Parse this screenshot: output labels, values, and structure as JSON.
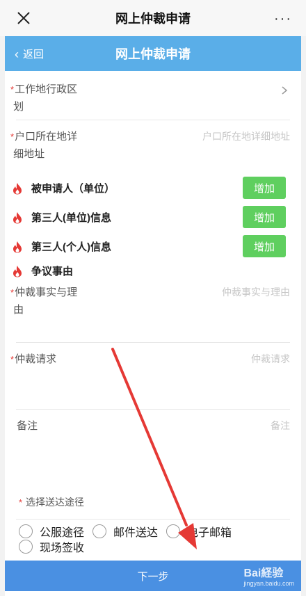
{
  "wx": {
    "title": "网上仲裁申请",
    "more": "···"
  },
  "nav": {
    "back_label": "返回",
    "title": "网上仲裁申请"
  },
  "form": {
    "work_district": {
      "required": "*",
      "label_line1": "工作地行政区",
      "label_line2": "划"
    },
    "household_address": {
      "required": "*",
      "label_line1": "户口所在地详",
      "label_line2": "细地址",
      "placeholder": "户口所在地详细地址"
    },
    "sections": [
      {
        "title": "被申请人（单位）",
        "button": "增加"
      },
      {
        "title": "第三人(单位)信息",
        "button": "增加"
      },
      {
        "title": "第三人(个人)信息",
        "button": "增加"
      },
      {
        "title": "争议事由"
      }
    ],
    "facts": {
      "required": "*",
      "label_line1": "仲裁事实与理",
      "label_line2": "由",
      "placeholder": "仲裁事实与理由"
    },
    "request": {
      "required": "*",
      "label": "仲裁请求",
      "placeholder": "仲裁请求"
    },
    "remarks": {
      "label": "备注",
      "placeholder": "备注"
    },
    "delivery": {
      "required": "*",
      "label": "选择送达途径",
      "options": [
        "公服途径",
        "邮件送达",
        "电子邮箱",
        "现场签收"
      ]
    }
  },
  "submit": {
    "label": "下一步"
  },
  "watermark": {
    "brand": "Bai経验",
    "url": "jingyan.baidu.com"
  },
  "colors": {
    "nav": "#5aaee8",
    "add_button": "#5fcf5f",
    "submit": "#4a90e2",
    "required": "#e53935",
    "annotation_arrow": "#e53935"
  }
}
